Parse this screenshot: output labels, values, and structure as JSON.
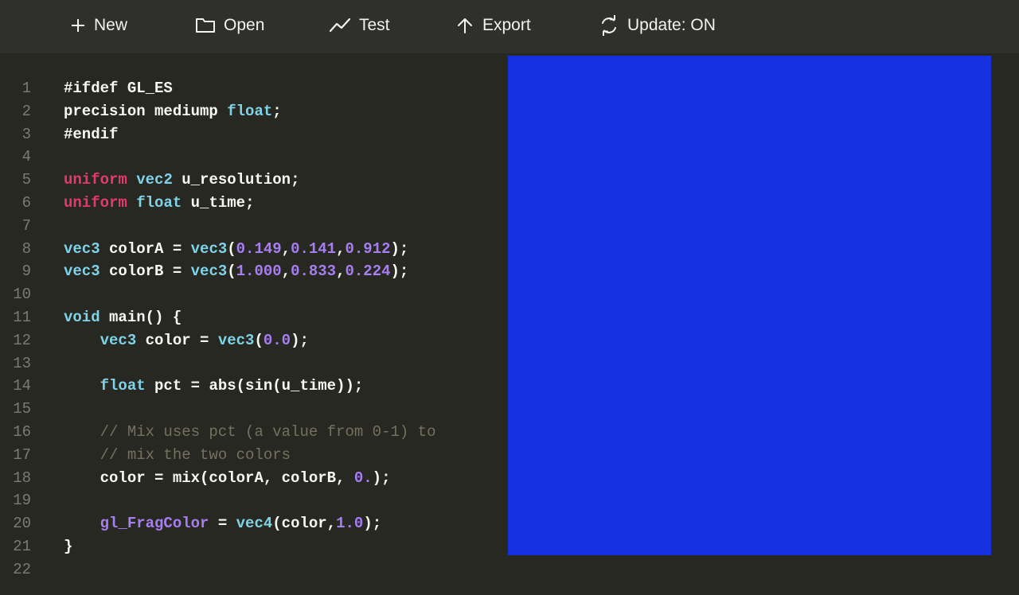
{
  "toolbar": {
    "buttons": [
      {
        "label": "New",
        "icon": "plus-icon"
      },
      {
        "label": "Open",
        "icon": "folder-icon"
      },
      {
        "label": "Test",
        "icon": "chart-line-icon"
      },
      {
        "label": "Export",
        "icon": "arrow-up-icon"
      },
      {
        "label": "Update: ON",
        "icon": "refresh-icon"
      }
    ]
  },
  "editor": {
    "lines": [
      {
        "n": "1",
        "tokens": [
          [
            "t",
            "#ifdef GL_ES"
          ]
        ]
      },
      {
        "n": "2",
        "tokens": [
          [
            "t",
            "precision mediump "
          ],
          [
            "type",
            "float"
          ],
          [
            "t",
            ";"
          ]
        ]
      },
      {
        "n": "3",
        "tokens": [
          [
            "t",
            "#endif"
          ]
        ]
      },
      {
        "n": "4",
        "tokens": []
      },
      {
        "n": "5",
        "tokens": [
          [
            "kw",
            "uniform"
          ],
          [
            "t",
            " "
          ],
          [
            "type",
            "vec2"
          ],
          [
            "t",
            " u_resolution;"
          ]
        ]
      },
      {
        "n": "6",
        "tokens": [
          [
            "kw",
            "uniform"
          ],
          [
            "t",
            " "
          ],
          [
            "type",
            "float"
          ],
          [
            "t",
            " u_time;"
          ]
        ]
      },
      {
        "n": "7",
        "tokens": []
      },
      {
        "n": "8",
        "tokens": [
          [
            "type",
            "vec3"
          ],
          [
            "t",
            " colorA = "
          ],
          [
            "type",
            "vec3"
          ],
          [
            "t",
            "("
          ],
          [
            "num",
            "0.149"
          ],
          [
            "t",
            ","
          ],
          [
            "num",
            "0.141"
          ],
          [
            "t",
            ","
          ],
          [
            "num",
            "0.912"
          ],
          [
            "t",
            ");"
          ]
        ]
      },
      {
        "n": "9",
        "tokens": [
          [
            "type",
            "vec3"
          ],
          [
            "t",
            " colorB = "
          ],
          [
            "type",
            "vec3"
          ],
          [
            "t",
            "("
          ],
          [
            "num",
            "1.000"
          ],
          [
            "t",
            ","
          ],
          [
            "num",
            "0.833"
          ],
          [
            "t",
            ","
          ],
          [
            "num",
            "0.224"
          ],
          [
            "t",
            ");"
          ]
        ]
      },
      {
        "n": "10",
        "tokens": []
      },
      {
        "n": "11",
        "tokens": [
          [
            "type",
            "void"
          ],
          [
            "t",
            " main() {"
          ]
        ]
      },
      {
        "n": "12",
        "tokens": [
          [
            "t",
            "    "
          ],
          [
            "type",
            "vec3"
          ],
          [
            "t",
            " color = "
          ],
          [
            "type",
            "vec3"
          ],
          [
            "t",
            "("
          ],
          [
            "num",
            "0.0"
          ],
          [
            "t",
            ");"
          ]
        ]
      },
      {
        "n": "13",
        "tokens": []
      },
      {
        "n": "14",
        "tokens": [
          [
            "t",
            "    "
          ],
          [
            "type",
            "float"
          ],
          [
            "t",
            " pct = abs(sin(u_time));"
          ]
        ]
      },
      {
        "n": "15",
        "tokens": []
      },
      {
        "n": "16",
        "tokens": [
          [
            "t",
            "    "
          ],
          [
            "comment",
            "// Mix uses pct (a value from 0-1) to"
          ]
        ]
      },
      {
        "n": "17",
        "tokens": [
          [
            "t",
            "    "
          ],
          [
            "comment",
            "// mix the two colors"
          ]
        ]
      },
      {
        "n": "18",
        "tokens": [
          [
            "t",
            "    color = mix(colorA, colorB, "
          ],
          [
            "num",
            "0."
          ],
          [
            "t",
            ");"
          ]
        ]
      },
      {
        "n": "19",
        "tokens": []
      },
      {
        "n": "20",
        "tokens": [
          [
            "t",
            "    "
          ],
          [
            "var",
            "gl_FragColor"
          ],
          [
            "t",
            " = "
          ],
          [
            "type",
            "vec4"
          ],
          [
            "t",
            "(color,"
          ],
          [
            "num",
            "1.0"
          ],
          [
            "t",
            ");"
          ]
        ]
      },
      {
        "n": "21",
        "tokens": [
          [
            "t",
            "}"
          ]
        ]
      },
      {
        "n": "22",
        "tokens": []
      }
    ]
  },
  "preview": {
    "color": "#1531e0"
  },
  "colors": {
    "toolbar_bg": "#2f302b",
    "editor_bg": "#272822",
    "type_token": "#7fd3e8",
    "keyword_token": "#e8386b",
    "number_token": "#a77df2",
    "comment_token": "#75715e"
  }
}
